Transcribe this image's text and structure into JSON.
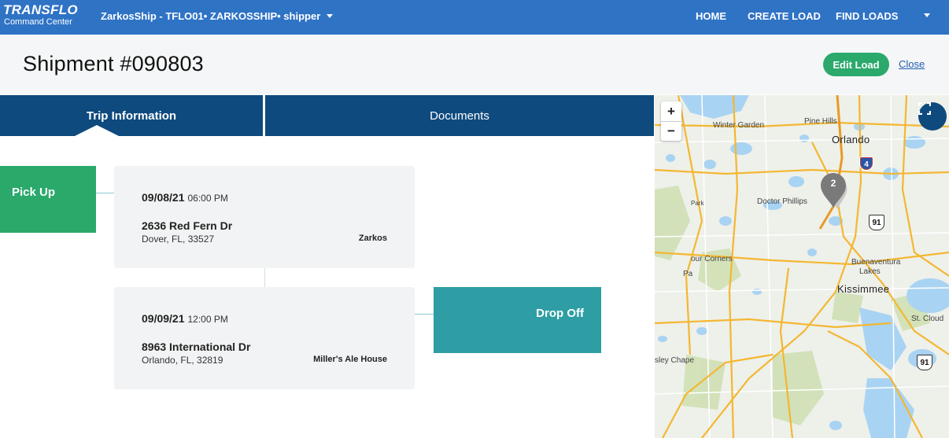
{
  "brand": {
    "logo_main": "TRANSFLO",
    "logo_sub": "Command Center"
  },
  "nav": {
    "account": "ZarkosShip - TFLO01• ZARKOSSHIP• shipper",
    "home": "HOME",
    "create_load": "CREATE LOAD",
    "find_loads": "FIND LOADS"
  },
  "header": {
    "title": "Shipment #090803",
    "edit_label": "Edit Load",
    "close_label": "Close"
  },
  "tabs": [
    {
      "label": "Trip Information",
      "active": true
    },
    {
      "label": "Documents",
      "active": false
    }
  ],
  "stops": [
    {
      "type_label": "Pick Up",
      "date": "09/08/21",
      "time": "06:00 PM",
      "address_line1": "2636 Red Fern Dr",
      "address_line2": "Dover, FL, 33527",
      "name": "Zarkos"
    },
    {
      "type_label": "Drop Off",
      "date": "09/09/21",
      "time": "12:00 PM",
      "address_line1": "8963 International Dr",
      "address_line2": "Orlando, FL, 32819",
      "name": "Miller's Ale House"
    }
  ],
  "map": {
    "zoom_in": "+",
    "zoom_out": "−",
    "cluster_count": "2",
    "labels": {
      "winter_garden": "Winter Garden",
      "pine_hills": "Pine Hills",
      "orlando": "Orlando",
      "doctor_phillips": "Doctor Phillips",
      "four_corners": "our Corners",
      "buenaventura": "Buenaventura",
      "lakes": "Lakes",
      "kissimmee": "Kissimmee",
      "st_cloud": "St. Cloud",
      "lley_chape": "sley Chape",
      "park": "Park",
      "pa": "Pa"
    },
    "shields": {
      "i4": "4",
      "fl91_top": "91",
      "fl91_bottom": "91"
    },
    "colors": {
      "water": "#a9d3f2",
      "road": "#f4b731",
      "park": "#cfe0b4",
      "land": "#eef0ea"
    }
  },
  "colors": {
    "nav_blue": "#2f73c5",
    "tab_navy": "#0e4a7e",
    "pickup_green": "#2aa96b",
    "dropoff_teal": "#2e9ea4"
  }
}
